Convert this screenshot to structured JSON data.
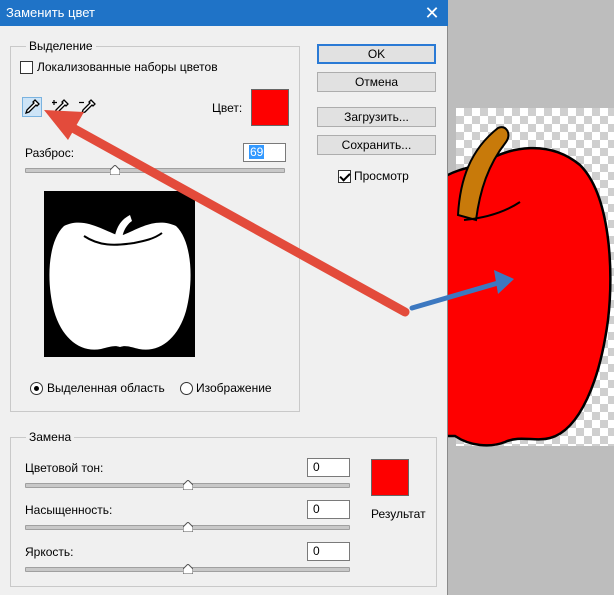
{
  "dialog": {
    "title": "Заменить цвет",
    "close_glyph": "✕"
  },
  "selection": {
    "group_label": "Выделение",
    "localized_label": "Локализованные наборы цветов",
    "localized_checked": false,
    "tools": [
      "eyedropper-icon",
      "eyedropper-plus-icon",
      "eyedropper-minus-icon"
    ],
    "color_label": "Цвет:",
    "color_value": "#fe0000",
    "fuzziness_label": "Разброс:",
    "fuzziness_value": "69",
    "fuzziness_fraction": 0.35,
    "radio_selection": "Выделенная область",
    "radio_image": "Изображение",
    "selected_radio": "selection"
  },
  "buttons": {
    "ok": "OK",
    "cancel": "Отмена",
    "load": "Загрузить...",
    "save": "Сохранить...",
    "preview": "Просмотр",
    "preview_checked": true
  },
  "replacement": {
    "group_label": "Замена",
    "hue_label": "Цветовой тон:",
    "hue_value": "0",
    "saturation_label": "Насыщенность:",
    "saturation_value": "0",
    "lightness_label": "Яркость:",
    "lightness_value": "0",
    "result_label": "Результат",
    "result_color": "#fe0000"
  },
  "colors": {
    "apple_red": "#fe0000",
    "stem": "#c87a0a",
    "arrow_red": "#e34b3b",
    "arrow_blue": "#3c78c0",
    "title_blue": "#1f73c7"
  }
}
